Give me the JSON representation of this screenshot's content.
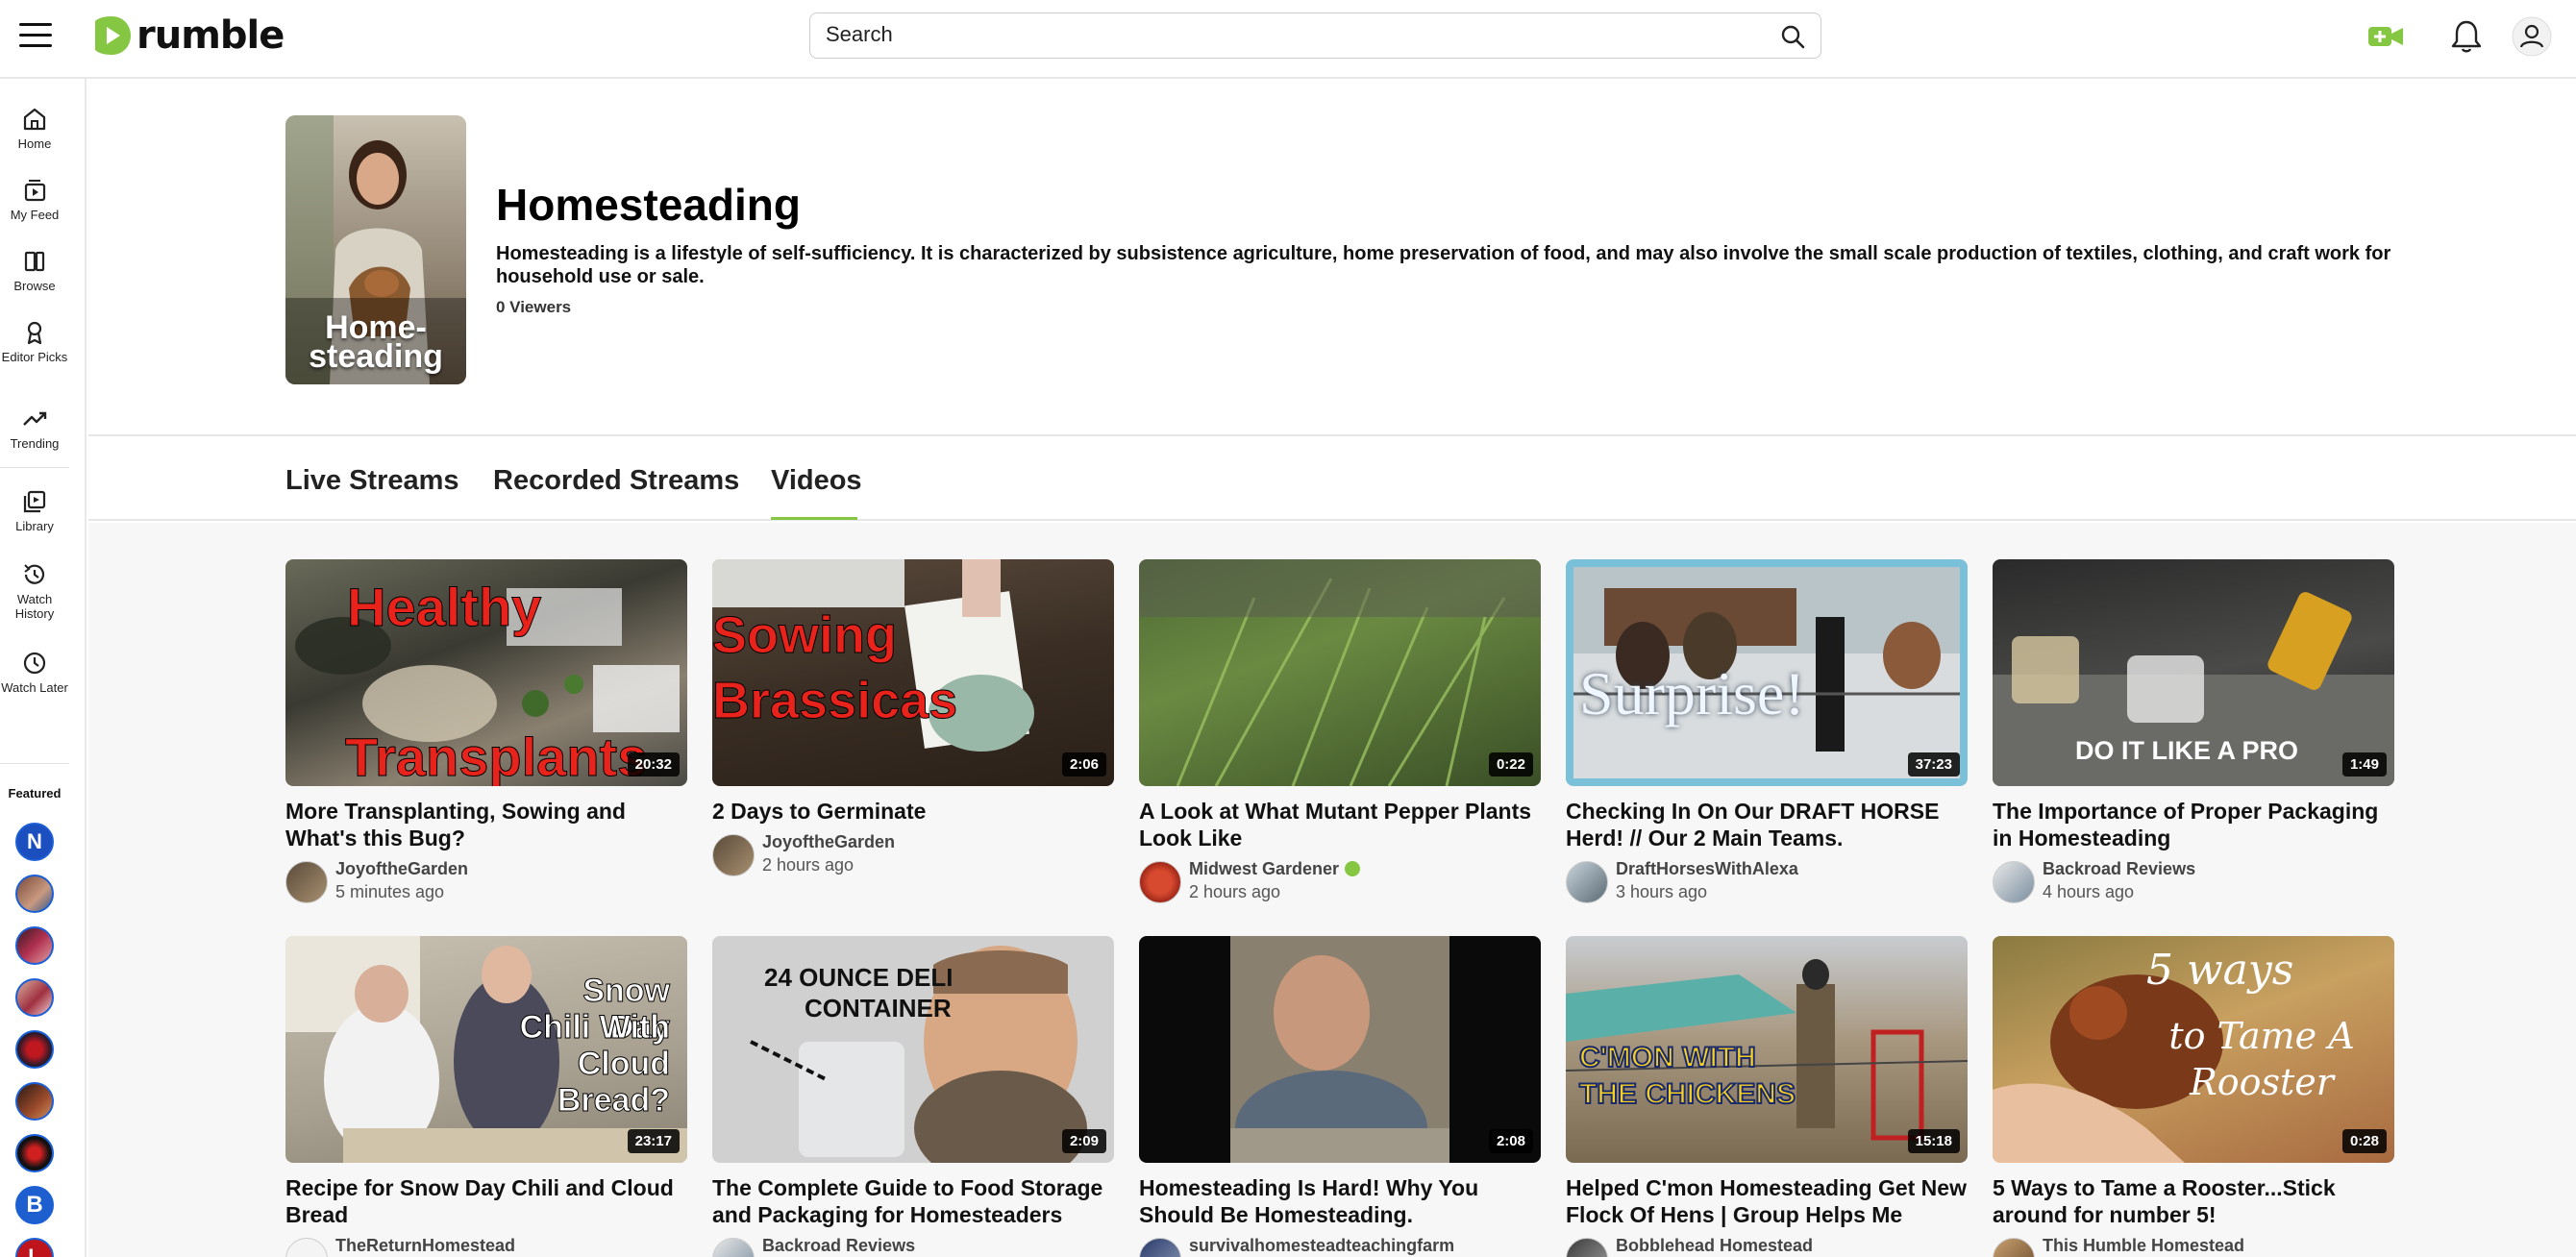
{
  "topbar": {
    "logo_text": "rumble",
    "search_placeholder": "Search",
    "brand_color": "#85c742"
  },
  "sidebar": {
    "items": [
      {
        "label": "Home",
        "icon": "home-icon"
      },
      {
        "label": "My Feed",
        "icon": "feed-icon"
      },
      {
        "label": "Browse",
        "icon": "browse-icon"
      },
      {
        "label": "Editor Picks",
        "icon": "editor-picks-icon"
      },
      {
        "label": "Trending",
        "icon": "trending-icon"
      },
      {
        "label": "Library",
        "icon": "library-icon"
      },
      {
        "label": "Watch History",
        "icon": "history-icon"
      },
      {
        "label": "Watch Later",
        "icon": "clock-icon"
      }
    ],
    "featured_label": "Featured",
    "featured_avatars": [
      "N",
      "",
      "",
      "",
      "",
      "",
      "",
      "B",
      "L"
    ]
  },
  "category": {
    "title": "Homesteading",
    "thumb_text_1": "Home-",
    "thumb_text_2": "steading",
    "description": "Homesteading is a lifestyle of self-sufficiency. It is characterized by subsistence agriculture, home preservation of food, and may also involve the small scale production of textiles, clothing, and craft work for household use or sale.",
    "viewers": "0 Viewers"
  },
  "tabs": [
    {
      "label": "Live Streams",
      "active": false
    },
    {
      "label": "Recorded Streams",
      "active": false
    },
    {
      "label": "Videos",
      "active": true
    }
  ],
  "videos": [
    {
      "title": "More Transplanting, Sowing and What's this Bug?",
      "channel": "JoyoftheGarden",
      "time": "5 minutes ago",
      "duration": "20:32",
      "overlay": "Healthy",
      "overlay2": "Transplants"
    },
    {
      "title": "2 Days to Germinate",
      "channel": "JoyoftheGarden",
      "time": "2 hours ago",
      "duration": "2:06",
      "overlay": "Sowing",
      "overlay2": "Brassicas"
    },
    {
      "title": "A Look at What Mutant Pepper Plants Look Like",
      "channel": "Midwest Gardener",
      "time": "2 hours ago",
      "duration": "0:22",
      "overlay": "",
      "overlay2": ""
    },
    {
      "title": "Checking In On Our DRAFT HORSE Herd! // Our 2 Main Teams.",
      "channel": "DraftHorsesWithAlexa",
      "time": "3 hours ago",
      "duration": "37:23",
      "overlay": "Surprise!",
      "overlay2": ""
    },
    {
      "title": "The Importance of Proper Packaging in Homesteading",
      "channel": "Backroad Reviews",
      "time": "4 hours ago",
      "duration": "1:49",
      "overlay": "DO IT LIKE A PRO",
      "overlay2": ""
    },
    {
      "title": "Recipe for Snow Day Chili and Cloud Bread",
      "channel": "TheReturnHomestead",
      "time": "",
      "duration": "23:17",
      "overlay": "Snow Day",
      "overlay2": "Chili With Cloud Bread?"
    },
    {
      "title": "The Complete Guide to Food Storage and Packaging for Homesteaders",
      "channel": "Backroad Reviews",
      "time": "",
      "duration": "2:09",
      "overlay": "24 OUNCE DELI",
      "overlay2": "CONTAINER"
    },
    {
      "title": "Homesteading Is Hard! Why You Should Be Homesteading.",
      "channel": "survivalhomesteadteachingfarm",
      "time": "",
      "duration": "2:08",
      "overlay": "",
      "overlay2": ""
    },
    {
      "title": "Helped C'mon Homesteading Get New Flock Of Hens | Group Helps Me With...",
      "channel": "Bobblehead Homestead",
      "time": "",
      "duration": "15:18",
      "overlay": "C'MON WITH",
      "overlay2": "THE CHICKENS"
    },
    {
      "title": "5 Ways to Tame a Rooster...Stick around for number 5!",
      "channel": "This Humble Homestead",
      "time": "",
      "duration": "0:28",
      "overlay": "5 ways",
      "overlay2": "to Tame A Rooster"
    }
  ]
}
